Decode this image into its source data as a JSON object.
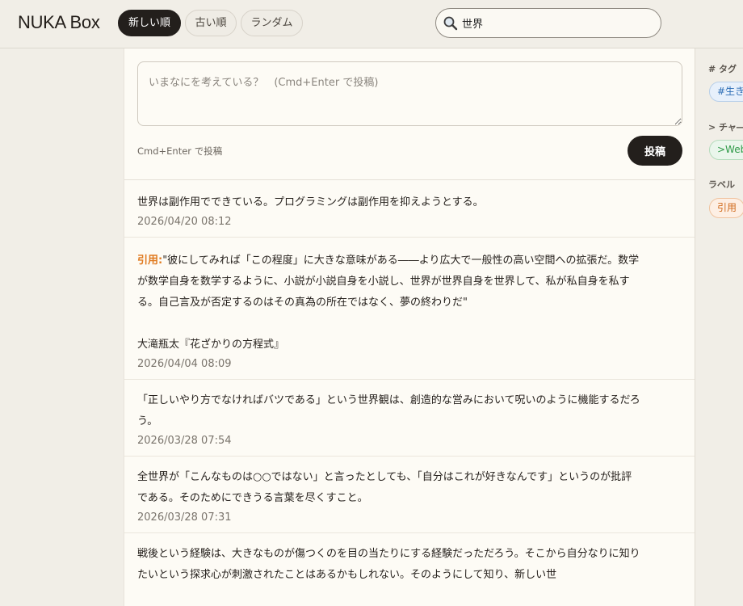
{
  "app": {
    "title": "NUKA Box"
  },
  "sort": {
    "newest": "新しい順",
    "oldest": "古い順",
    "random": "ランダム"
  },
  "search": {
    "value": "世界",
    "placeholder": ""
  },
  "composer": {
    "placeholder": "いまなにを考えている？　(Cmd+Enter で投稿)",
    "hint": "Cmd+Enter で投稿",
    "post_label": "投稿"
  },
  "posts": [
    {
      "text": "世界は副作用でできている。プログラミングは副作用を抑えようとする。",
      "date": "2026/04/20 08:12"
    },
    {
      "label": "引用:",
      "text": "\"彼にしてみれば「この程度」に大きな意味がある――より広大で一般性の高い空間への拡張だ。数学が数学自身を数学するように、小説が小説自身を小説し、世界が世界自身を世界して、私が私自身を私する。自己言及が否定するのはその真為の所在ではなく、夢の終わりだ\"\n\n大滝瓶太『花ざかりの方程式』",
      "date": "2026/04/04 08:09"
    },
    {
      "text": "「正しいやり方でなければバツである」という世界観は、創造的な営みにおいて呪いのように機能するだろう。",
      "date": "2026/03/28 07:54"
    },
    {
      "text": "全世界が「こんなものは○○ではない」と言ったとしても、「自分はこれが好きなんです」というのが批評である。そのためにできうる言葉を尽くすこと。",
      "date": "2026/03/28 07:31"
    },
    {
      "text": "戦後という経験は、大きなものが傷つくのを目の当たりにする経験だっただろう。そこから自分なりに知りたいという探求心が刺激されたことはあるかもしれない。そのようにして知り、新しい世",
      "date": ""
    }
  ],
  "sidebar": {
    "tags_heading": "# タグ",
    "tag_chip": "#生き",
    "channels_heading": "> チャ―",
    "channel_chip": ">Web",
    "labels_heading": "ラベル",
    "label_chip": "引用"
  },
  "colors": {
    "accent_dark": "#231f1c",
    "quote_label": "#e07a1f",
    "tag": "#2c6db5",
    "channel": "#2f9a48",
    "label": "#d06a1c"
  }
}
